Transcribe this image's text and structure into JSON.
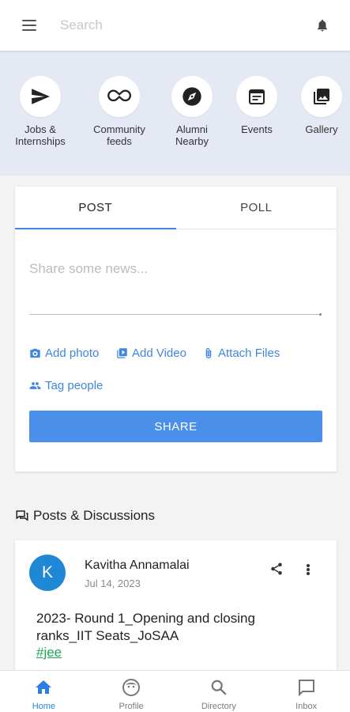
{
  "topbar": {
    "search_placeholder": "Search"
  },
  "quick_links": [
    {
      "label": "Jobs &\nInternships",
      "icon": "send-icon"
    },
    {
      "label": "Community\nfeeds",
      "icon": "infinity-icon"
    },
    {
      "label": "Alumni\nNearby",
      "icon": "compass-icon"
    },
    {
      "label": "Events",
      "icon": "calendar-icon"
    },
    {
      "label": "Gallery",
      "icon": "gallery-icon"
    }
  ],
  "composer": {
    "tabs": [
      {
        "label": "POST",
        "active": true
      },
      {
        "label": "POLL",
        "active": false
      }
    ],
    "placeholder": "Share some news...",
    "add_photo": "Add photo",
    "add_video": "Add Video",
    "attach_files": "Attach Files",
    "tag_people": "Tag people",
    "share_label": "SHARE"
  },
  "section": {
    "title": "Posts & Discussions"
  },
  "post": {
    "avatar_initial": "K",
    "author": "Kavitha Annamalai",
    "date": "Jul 14, 2023",
    "text": "2023- Round 1_Opening and closing ranks_IIT Seats_JoSAA",
    "hashtag": "#jee"
  },
  "bottom_nav": [
    {
      "label": "Home",
      "active": true
    },
    {
      "label": "Profile",
      "active": false
    },
    {
      "label": "Directory",
      "active": false
    },
    {
      "label": "Inbox",
      "active": false
    }
  ],
  "colors": {
    "accent": "#3f86e0",
    "strip": "#e4e9f4",
    "avatar": "#1e88d6",
    "hashtag": "#1fa554"
  }
}
